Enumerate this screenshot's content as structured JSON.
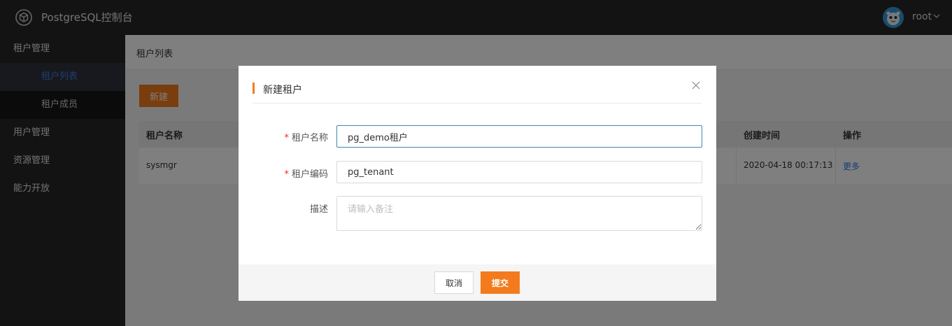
{
  "header": {
    "app_title": "PostgreSQL控制台",
    "user": "root",
    "logo_icon": "cube-icon",
    "accent": "#f37b1d"
  },
  "sidebar": {
    "items": [
      {
        "label": "租户管理"
      },
      {
        "label": "租户列表",
        "active": true
      },
      {
        "label": "租户成员"
      },
      {
        "label": "用户管理"
      },
      {
        "label": "资源管理"
      },
      {
        "label": "能力开放"
      }
    ]
  },
  "main": {
    "title": "租户列表",
    "new_button": "新建",
    "table": {
      "headers": [
        "租户名称",
        "创建时间",
        "操作"
      ],
      "rows": [
        {
          "name": "sysmgr",
          "created": "2020-04-18 00:17:13",
          "action": "更多"
        }
      ]
    }
  },
  "modal": {
    "title": "新建租户",
    "fields": [
      {
        "label": "租户名称",
        "required": true,
        "value": "pg_demo租户"
      },
      {
        "label": "租户编码",
        "required": true,
        "value": "pg_tenant"
      },
      {
        "label": "描述",
        "required": false,
        "value": "",
        "placeholder": "请输入备注"
      }
    ],
    "cancel": "取消",
    "submit": "提交"
  }
}
